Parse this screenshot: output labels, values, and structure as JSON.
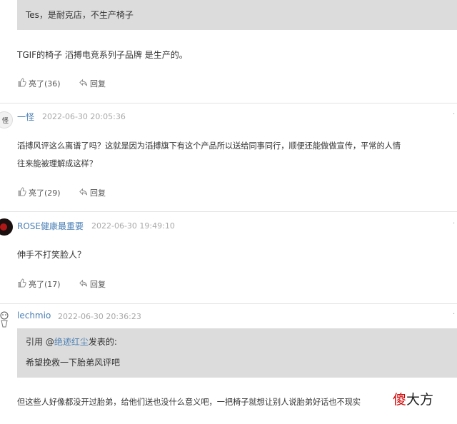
{
  "comments": [
    {
      "quote": "Tes，是耐克店，不生产椅子",
      "body": "TGIF的椅子 滔搏电竞系列子品牌 是生产的。",
      "like_label": "亮了(36)",
      "reply_label": "回复"
    },
    {
      "avatar_text": "怪",
      "username": "一怪",
      "time": "2022-06-30 20:05:36",
      "body_line1": "滔搏风评这么离谱了吗？这就是因为滔搏旗下有这个产品所以送给同事同行，顺便还能做做宣传，平常的人情",
      "body_line2": "往来能被理解成这样？",
      "like_label": "亮了(29)",
      "reply_label": "回复"
    },
    {
      "username": "ROSE健康最重要",
      "time": "2022-06-30 19:49:10",
      "body": "伸手不打笑脸人？",
      "like_label": "亮了(17)",
      "reply_label": "回复"
    },
    {
      "username": "lechmio",
      "time": "2022-06-30 20:36:23",
      "quote_prefix": "引用 @",
      "quote_user": "绝迹红尘",
      "quote_suffix": "发表的:",
      "quote_text": "希望挽救一下胎弟风评吧",
      "body": "但这些人好像都没开过胎弟，给他们送也没什么意义吧，一把椅子就想让别人说胎弟好话也不现实"
    }
  ],
  "watermark": {
    "char1": "傻",
    "char2": "大方"
  },
  "colors": {
    "link": "#4a7fb5",
    "quote_bg": "#dcdcdc",
    "watermark": "#d10000"
  }
}
